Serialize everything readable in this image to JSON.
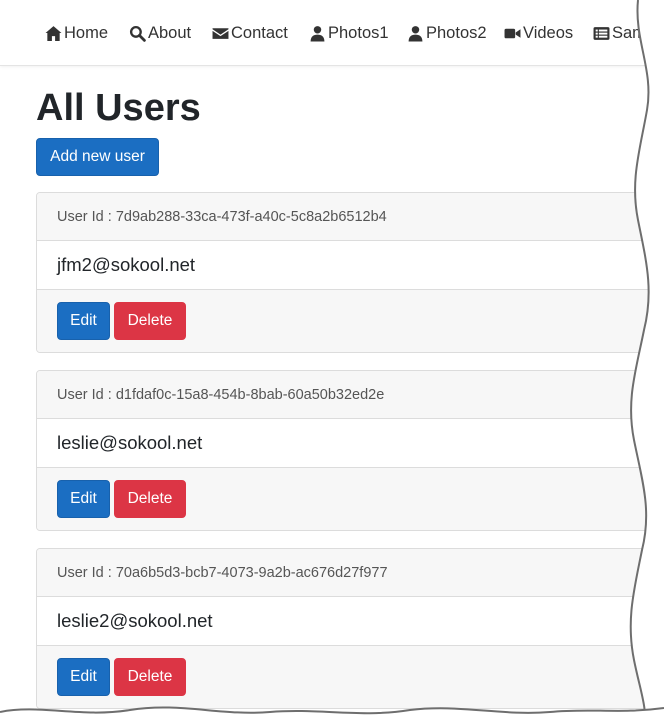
{
  "nav": {
    "items": [
      {
        "label": "Home",
        "icon": "home-icon"
      },
      {
        "label": "About",
        "icon": "search-icon"
      },
      {
        "label": "Contact",
        "icon": "envelope-icon"
      },
      {
        "label": "Photos1",
        "icon": "user-icon"
      },
      {
        "label": "Photos2",
        "icon": "user-icon"
      },
      {
        "label": "Videos",
        "icon": "video-camera-icon"
      },
      {
        "label": "Sample",
        "icon": "list-icon"
      }
    ]
  },
  "page": {
    "title": "All Users",
    "add_button": "Add new user"
  },
  "users": [
    {
      "id_label": "User Id : 7d9ab288-33ca-473f-a40c-5c8a2b6512b4",
      "email": "jfm2@sokool.net",
      "edit": "Edit",
      "delete": "Delete"
    },
    {
      "id_label": "User Id : d1fdaf0c-15a8-454b-8bab-60a50b32ed2e",
      "email": "leslie@sokool.net",
      "edit": "Edit",
      "delete": "Delete"
    },
    {
      "id_label": "User Id : 70a6b5d3-bcb7-4073-9a2b-ac676d27f977",
      "email": "leslie2@sokool.net",
      "edit": "Edit",
      "delete": "Delete"
    }
  ],
  "colors": {
    "primary": "#1b6ec2",
    "danger": "#dc3545",
    "card_header_bg": "#f7f7f7"
  }
}
